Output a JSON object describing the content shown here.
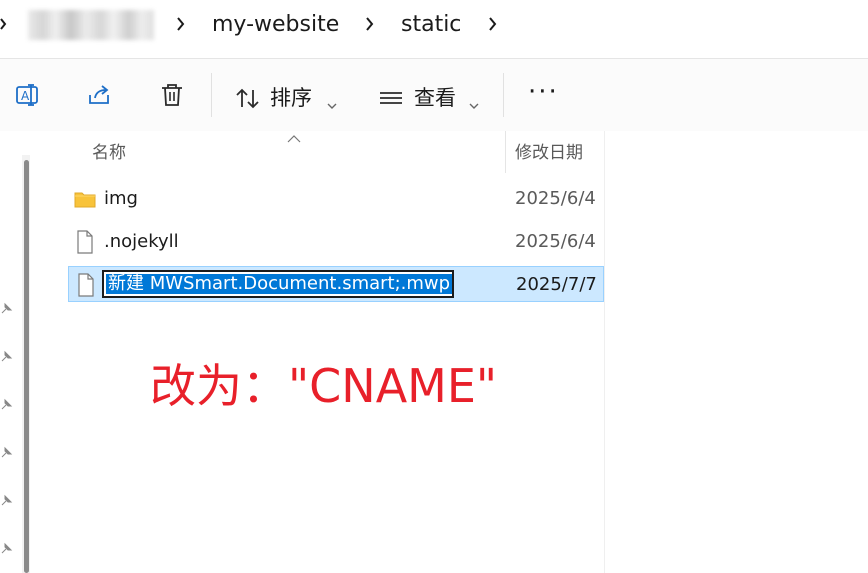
{
  "breadcrumb": {
    "items": [
      {
        "label": "my-website"
      },
      {
        "label": "static"
      }
    ]
  },
  "toolbar": {
    "sort_label": "排序",
    "view_label": "查看",
    "more_label": "···"
  },
  "file_list": {
    "columns": {
      "name": "名称",
      "date_modified": "修改日期"
    },
    "rows": [
      {
        "name": "img",
        "date": "2025/6/4",
        "type": "folder"
      },
      {
        "name": ".nojekyll",
        "date": "2025/6/4",
        "type": "file"
      },
      {
        "name": "新建 MWSmart.Document.smart;.mwp",
        "date": "2025/7/7",
        "type": "file",
        "selected": true,
        "editing": true
      }
    ]
  },
  "annotation": {
    "text": "改为：\"CNAME\"",
    "color": "#e8202a"
  },
  "colors": {
    "selection_bg": "#cce8ff",
    "selection_border": "#99d1ff",
    "text_highlight": "#0078d7",
    "folder_yellow": "#f8c33a"
  }
}
